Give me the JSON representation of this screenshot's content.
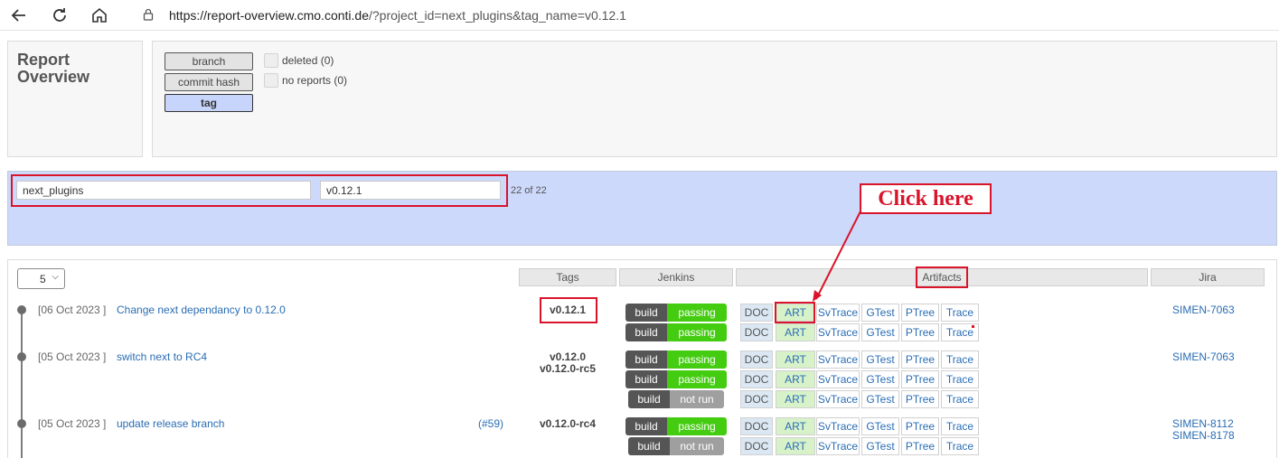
{
  "browser": {
    "url_host": "https://report-overview.cmo.conti.de",
    "url_rest": "/?project_id=next_plugins&tag_name=v0.12.1"
  },
  "header": {
    "title_line1": "Report",
    "title_line2": "Overview",
    "toggles": [
      "branch",
      "commit hash",
      "tag"
    ],
    "active_toggle": "tag",
    "checkboxes": [
      "deleted (0)",
      "no reports (0)"
    ]
  },
  "filter": {
    "project_value": "next_plugins",
    "tag_value": "v0.12.1",
    "count": "22 of 22"
  },
  "annotation": {
    "callout": "Click here"
  },
  "table": {
    "page_size": "5",
    "columns": [
      "Tags",
      "Jenkins",
      "Artifacts",
      "Jira"
    ],
    "artifact_labels": [
      "DOC",
      "ART",
      "SvTrace",
      "GTest",
      "PTree",
      "Trace"
    ],
    "build_label": "build",
    "rows": [
      {
        "date": "[06 Oct 2023  ]",
        "message": "Change next dependancy to 0.12.0",
        "pr": "",
        "tags": [
          "v0.12.1"
        ],
        "builds": [
          "passing",
          "passing"
        ],
        "jira": [
          "SIMEN-7063"
        ]
      },
      {
        "date": "[05 Oct 2023  ]",
        "message": "switch next to RC4",
        "pr": "",
        "tags": [
          "v0.12.0",
          "v0.12.0-rc5"
        ],
        "builds": [
          "passing",
          "passing",
          "not run"
        ],
        "jira": [
          "SIMEN-7063"
        ]
      },
      {
        "date": "[05 Oct 2023  ]",
        "message": "update release branch",
        "pr": "(#59)",
        "tags": [
          "v0.12.0-rc4"
        ],
        "builds": [
          "passing",
          "not run"
        ],
        "jira": [
          "SIMEN-8112",
          "SIMEN-8178"
        ]
      }
    ]
  },
  "colors": {
    "accent_red": "#d9142b",
    "passing": "#44cc11",
    "not_run": "#9f9f9f",
    "link": "#2a6db4",
    "filter_bg": "#ccd9fb"
  }
}
